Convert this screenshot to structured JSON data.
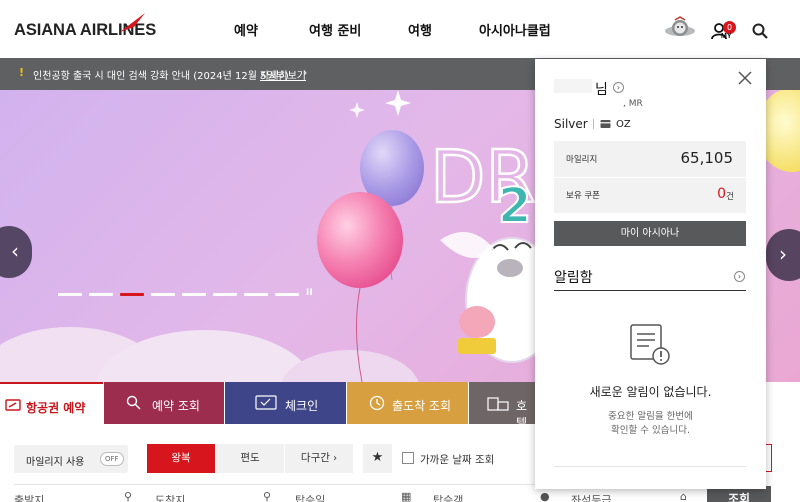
{
  "header": {
    "logo_text": "ASIANA AIRLINES",
    "nav": [
      "예약",
      "여행 준비",
      "여행",
      "아시아나클럽"
    ],
    "my_badge": "0",
    "my_label": "MY"
  },
  "notice": {
    "text": "인천공항 출국 시 대인 검색 강화 안내 (2024년 12월 5일부)",
    "link": "자세히보기"
  },
  "hero": {
    "banner_text": "DREAM",
    "slide_count": 8,
    "active_slide": 3
  },
  "tabs": [
    {
      "label": "항공권 예약",
      "icon": "ticket-icon"
    },
    {
      "label": "예약 조회",
      "icon": "search-icon"
    },
    {
      "label": "체크인",
      "icon": "boarding-pass-icon"
    },
    {
      "label": "출도착 조회",
      "icon": "clock-icon"
    },
    {
      "label": "호텔",
      "icon": "hotel-icon"
    }
  ],
  "booking": {
    "mileage_label": "마일리지 사용",
    "mileage_toggle": "OFF",
    "trip_types": [
      "왕복",
      "편도",
      "다구간"
    ],
    "nearby_label": "가까운 날짜 조회",
    "field_labels": [
      "출발지",
      "도착지",
      "탑승일",
      "탑승객",
      "좌석등급"
    ],
    "search_label": "조회"
  },
  "panel": {
    "name_suffix": "님",
    "title_suffix": ", MR",
    "tier": "Silver",
    "airline_code": "OZ",
    "mileage_label": "마일리지",
    "mileage_value": "65,105",
    "coupon_label": "보유 쿠폰",
    "coupon_value": "0",
    "coupon_unit": "건",
    "my_asiana": "마이 아시아나",
    "inbox_title": "알림함",
    "empty_title": "새로운 알림이 없습니다.",
    "empty_desc_1": "중요한 알림을 한번에",
    "empty_desc_2": "확인할 수 있습니다."
  },
  "colors": {
    "brand_red": "#d7151d",
    "tab_red": "#c8161d",
    "tab_wine": "#9c2d4f",
    "tab_navy": "#3f4589",
    "tab_gold": "#d79f40",
    "tab_grey": "#6e6566",
    "notice_bg": "#5f6062"
  }
}
